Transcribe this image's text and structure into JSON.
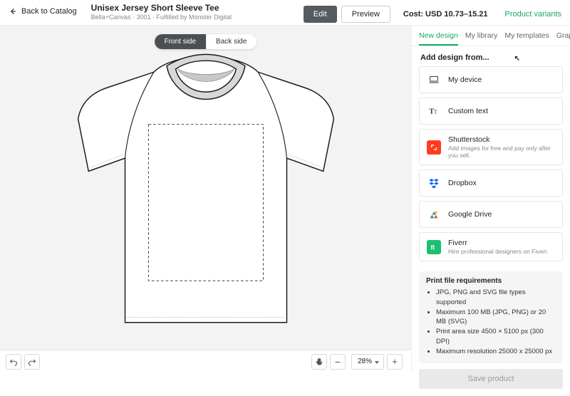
{
  "header": {
    "back_label": "Back to Catalog",
    "title": "Unisex Jersey Short Sleeve Tee",
    "subtitle": "Bella+Canvas · 3001 · Fulfilled by Monster Digital",
    "edit_label": "Edit",
    "preview_label": "Preview",
    "cost_label": "Cost: USD 10.73–15.21",
    "variants_label": "Product variants"
  },
  "canvas": {
    "front_label": "Front side",
    "back_label": "Back side",
    "zoom": "28%"
  },
  "side": {
    "tabs": {
      "new": "New design",
      "library": "My library",
      "templates": "My templates",
      "graphics": "Graphics"
    },
    "add_from_label": "Add design from...",
    "options": {
      "device": "My device",
      "custom_text": "Custom text",
      "shutter": {
        "name": "Shutterstock",
        "desc": "Add images for free and pay only after you sell."
      },
      "dropbox": "Dropbox",
      "gdrive": "Google Drive",
      "fiverr": {
        "name": "Fiverr",
        "desc": "Hire professional designers on Fiverr."
      }
    },
    "req": {
      "title": "Print file requirements",
      "l1": "JPG, PNG and SVG file types supported",
      "l2": "Maximum 100 MB (JPG, PNG) or 20 MB (SVG)",
      "l3": "Print area size 4500 × 5100 px (300 DPI)",
      "l4": "Maximum resolution 25000 x 25000 px"
    },
    "save_label": "Save product"
  }
}
